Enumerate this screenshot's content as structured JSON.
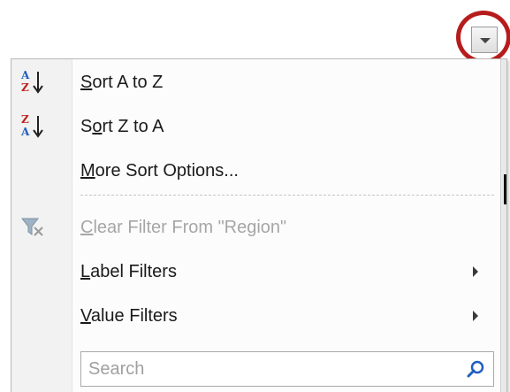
{
  "dropdown_button": {
    "icon": "dropdown-arrow-icon"
  },
  "highlight_color": "#b71c1c",
  "menu": {
    "items": [
      {
        "label": "Sort A to Z",
        "underline_char": "S",
        "icon": "sort-ascending-icon",
        "enabled": true,
        "submenu": false
      },
      {
        "label": "Sort Z to A",
        "underline_char": "o",
        "icon": "sort-descending-icon",
        "enabled": true,
        "submenu": false
      },
      {
        "label": "More Sort Options...",
        "underline_char": "M",
        "icon": null,
        "enabled": true,
        "submenu": false
      },
      {
        "label": "Clear Filter From \"Region\"",
        "underline_char": "C",
        "icon": "clear-filter-icon",
        "enabled": false,
        "submenu": false
      },
      {
        "label": "Label Filters",
        "underline_char": "L",
        "icon": null,
        "enabled": true,
        "submenu": true
      },
      {
        "label": "Value Filters",
        "underline_char": "V",
        "icon": null,
        "enabled": true,
        "submenu": true
      }
    ],
    "search": {
      "placeholder": "Search",
      "icon": "search-icon"
    }
  },
  "colors": {
    "text": "#1a1a1a",
    "disabled_text": "#a6a6a6",
    "sort_blue": "#1f5fbf",
    "sort_red": "#c0231e",
    "search_icon": "#1f5fbf"
  }
}
